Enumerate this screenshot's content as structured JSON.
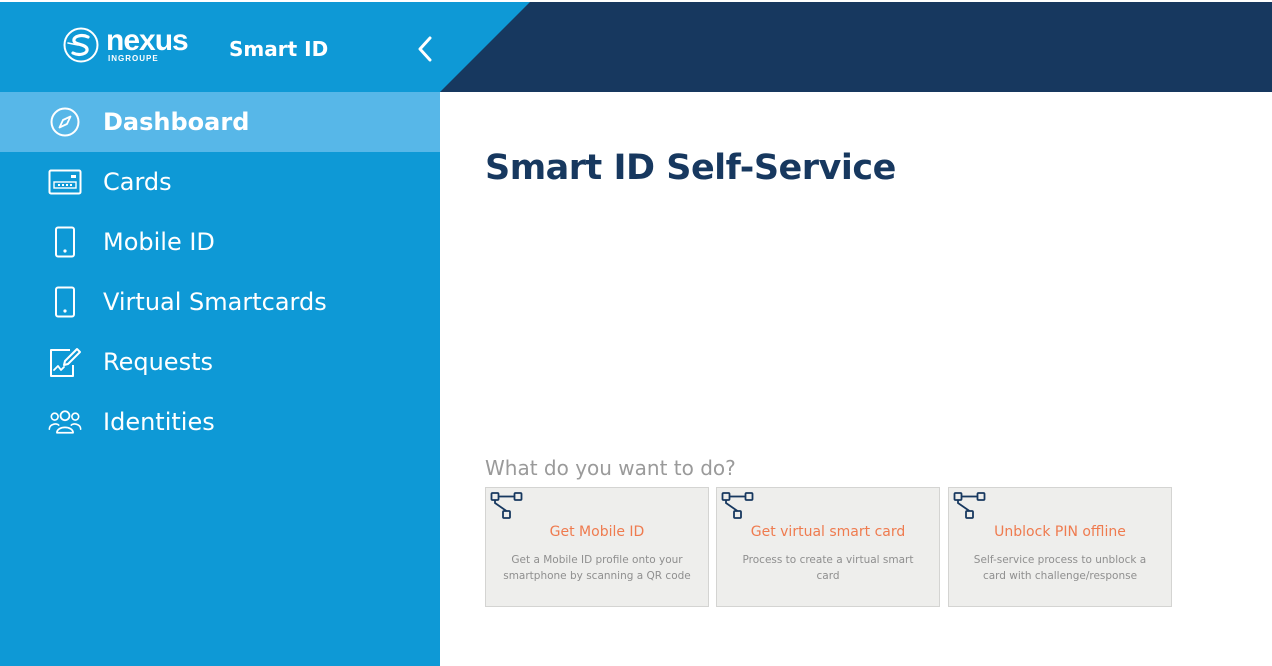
{
  "brand": {
    "word": "nexus",
    "sub": "INGROUPE",
    "app_name": "Smart ID"
  },
  "colors": {
    "sidebar": "#0e99d6",
    "active": "#57b7e8",
    "header_dark": "#17385f",
    "accent": "#ef7b4f",
    "tile_bg": "#eeeeec"
  },
  "sidebar": {
    "collapse_icon": "chevron-left-icon",
    "items": [
      {
        "label": "Dashboard",
        "icon": "compass-icon",
        "active": true
      },
      {
        "label": "Cards",
        "icon": "card-icon",
        "active": false
      },
      {
        "label": "Mobile ID",
        "icon": "phone-icon",
        "active": false
      },
      {
        "label": "Virtual Smartcards",
        "icon": "phone-icon",
        "active": false
      },
      {
        "label": "Requests",
        "icon": "edit-document-icon",
        "active": false
      },
      {
        "label": "Identities",
        "icon": "users-icon",
        "active": false
      }
    ]
  },
  "main": {
    "title": "Smart ID Self-Service",
    "section_label": "What do you want to do?",
    "tiles": [
      {
        "title": "Get Mobile ID",
        "description": "Get a Mobile ID profile onto your smartphone by scanning a QR code",
        "icon": "workflow-icon"
      },
      {
        "title": "Get virtual smart card",
        "description": "Process to create a virtual smart card",
        "icon": "workflow-icon"
      },
      {
        "title": "Unblock PIN offline",
        "description": "Self-service process to unblock a card with challenge/response",
        "icon": "workflow-icon"
      }
    ]
  }
}
